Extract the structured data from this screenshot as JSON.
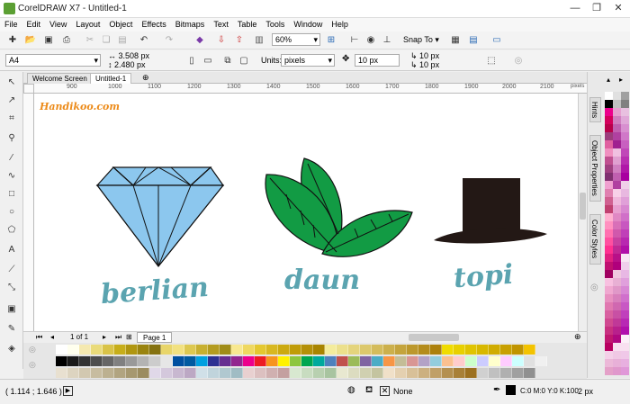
{
  "window": {
    "title": "CorelDRAW X7 - Untitled-1",
    "minimize": "—",
    "restore": "❐",
    "close": "✕"
  },
  "menu": [
    "File",
    "Edit",
    "View",
    "Layout",
    "Object",
    "Effects",
    "Bitmaps",
    "Text",
    "Table",
    "Tools",
    "Window",
    "Help"
  ],
  "toolbar": {
    "zoom": "60%",
    "snap_to": "Snap To"
  },
  "property_bar": {
    "page_size": "A4",
    "width": "3.508 px",
    "height": "2.480 px",
    "units_label": "Units:",
    "units": "pixels",
    "nudge": "10 px",
    "dup_x": "10 px",
    "dup_y": "10 px"
  },
  "tabs": {
    "welcome": "Welcome Screen",
    "doc": "Untitled-1"
  },
  "ruler": {
    "h": [
      "900",
      "1000",
      "1100",
      "1200",
      "1300",
      "1400",
      "1500",
      "1600",
      "1700",
      "1800",
      "1900",
      "2000",
      "2100"
    ],
    "unit": "pixels"
  },
  "canvas": {
    "watermark": "Handikoo.com",
    "labels": [
      "berlian",
      "daun",
      "topi"
    ]
  },
  "page_nav": {
    "count": "1 of 1",
    "page_tab": "Page 1"
  },
  "dockers": {
    "hints": "Hints",
    "object_properties": "Object Properties",
    "color_styles": "Color Styles"
  },
  "status": {
    "coords": "( 1.114 ; 1.646 )",
    "fill": "None",
    "outline_color": "C:0 M:0 Y:0 K:100",
    "outline_width": "2 px"
  },
  "colors": {
    "diamond": "#8cc7ee",
    "leaf": "#129b44",
    "hat": "#231815",
    "label": "#5ba4b0",
    "watermark": "#ec8b1a"
  }
}
